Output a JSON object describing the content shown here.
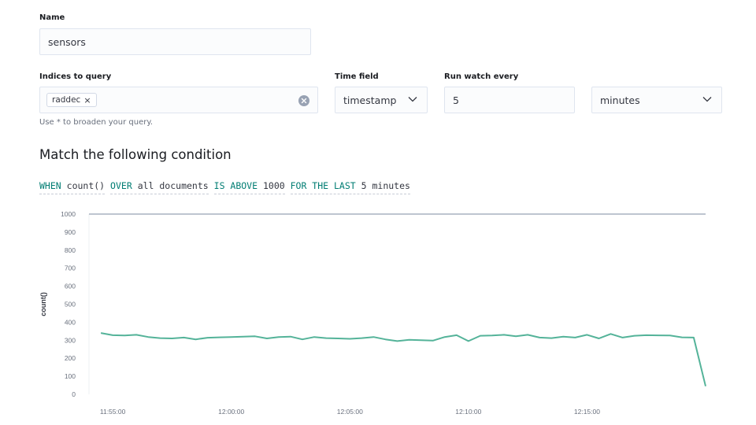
{
  "form": {
    "name_label": "Name",
    "name_value": "sensors",
    "indices_label": "Indices to query",
    "indices": [
      "raddec"
    ],
    "indices_help": "Use * to broaden your query.",
    "time_field_label": "Time field",
    "time_field_value": "timestamp",
    "run_every_label": "Run watch every",
    "run_every_value": "5",
    "run_every_unit": "minutes"
  },
  "condition": {
    "heading": "Match the following condition",
    "when_kw": "WHEN",
    "agg": "count()",
    "over_kw": "OVER",
    "over_value": "all documents",
    "threshold_kw": "IS ABOVE",
    "threshold_value": "1000",
    "window_kw": "FOR THE LAST",
    "window_value": "5 minutes"
  },
  "chart_data": {
    "type": "line",
    "ylabel": "count()",
    "ylim": [
      0,
      1000
    ],
    "yticks": [
      0,
      100,
      200,
      300,
      400,
      500,
      600,
      700,
      800,
      900,
      1000
    ],
    "x_ticks": [
      "11:55:00",
      "12:00:00",
      "12:05:00",
      "12:10:00",
      "12:15:00"
    ],
    "x_tick_minutes": [
      0,
      5,
      10,
      15,
      20
    ],
    "threshold": 1000,
    "series": [
      {
        "color": "#54b399",
        "x_minutes": [
          -0.5,
          0,
          0.5,
          1,
          1.5,
          2,
          2.5,
          3,
          3.5,
          4,
          4.5,
          5,
          5.5,
          6,
          6.5,
          7,
          7.5,
          8,
          8.5,
          9,
          9.5,
          10,
          10.5,
          11,
          11.5,
          12,
          12.5,
          13,
          13.5,
          14,
          14.5,
          15,
          15.5,
          16,
          16.5,
          17,
          17.5,
          18,
          18.5,
          19,
          19.5,
          20,
          20.5,
          21,
          21.5,
          22,
          22.5,
          23,
          23.5,
          24,
          24.5,
          25
        ],
        "values": [
          340,
          328,
          326,
          330,
          318,
          312,
          310,
          315,
          305,
          314,
          316,
          318,
          320,
          322,
          310,
          318,
          320,
          305,
          318,
          312,
          310,
          308,
          312,
          318,
          305,
          295,
          302,
          300,
          298,
          318,
          328,
          295,
          325,
          326,
          330,
          322,
          330,
          315,
          312,
          320,
          315,
          330,
          310,
          335,
          315,
          325,
          328,
          327,
          326,
          316,
          315,
          45
        ]
      }
    ]
  }
}
